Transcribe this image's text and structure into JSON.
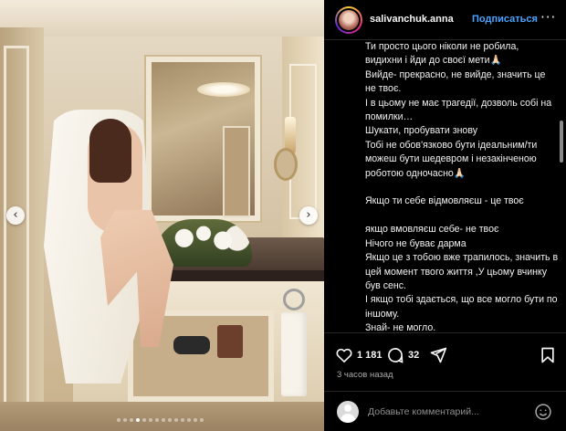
{
  "post": {
    "username": "salivanchuk.anna",
    "follow_label": "Подписаться",
    "more_glyph": "···",
    "caption": "Ти просто цього ніколи не робила,\nвидихни і йди до своєї мети🙏🏻\nВийде- прекрасно, не вийде, значить це не твоє.\nІ в цьому не має трагедії, дозволь собі на помилки…\nШукати, пробувати знову\nТобі не обов'язково бути ідеальним/ти можеш бути шедевром і незакінченою роботою одночасно🙏🏻\n\nЯкщо ти себе відмовляєш - це твоє\n\nякщо вмовляєш себе- не твоє\nНічого не буває дарма\nЯкщо це з тобою вже трапилось, значить в цей момент твого життя ,У цьому вчинку був сенс.\nІ якщо тобі здається, що все могло бути по іншому.\nЗнай- не могло.\nСпробуй кайфувати від життя без",
    "likes": "1 181",
    "comments": "32",
    "timestamp": "3 часов назад",
    "comment_placeholder": "Добавьте комментарий..."
  },
  "carousel": {
    "prev_glyph": "‹",
    "next_glyph": "›",
    "slide_count": 14,
    "active_index": 3
  },
  "icons": {
    "like": "heart-icon",
    "comment": "comment-bubble-icon",
    "share": "paper-plane-icon",
    "save": "bookmark-icon",
    "emoji": "smiley-icon"
  },
  "colors": {
    "follow": "#4aa3ff",
    "background": "#000000",
    "muted": "#a8a8a8"
  }
}
